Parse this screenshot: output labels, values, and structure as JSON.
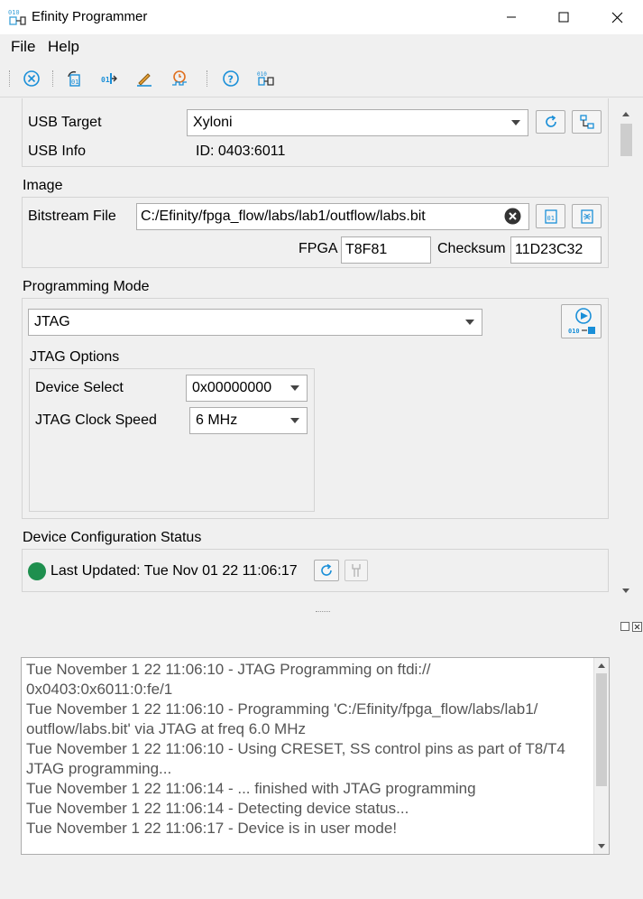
{
  "window": {
    "title": "Efinity Programmer"
  },
  "menu": {
    "file": "File",
    "help": "Help"
  },
  "toolbar": {
    "icons": [
      "stop-icon",
      "open-bitstream-icon",
      "output-icon",
      "edit-icon",
      "timing-icon",
      "help-icon",
      "programmer-icon"
    ]
  },
  "usb": {
    "target_label": "USB Target",
    "target_value": "Xyloni",
    "info_label": "USB Info",
    "info_value": "ID: 0403:6011"
  },
  "image": {
    "section_title": "Image",
    "bitstream_label": "Bitstream File",
    "bitstream_value": "C:/Efinity/fpga_flow/labs/lab1/outflow/labs.bit",
    "fpga_label": "FPGA",
    "fpga_value": "T8F81",
    "checksum_label": "Checksum",
    "checksum_value": "11D23C32"
  },
  "programming": {
    "section_title": "Programming Mode",
    "mode_value": "JTAG",
    "jtag_options_title": "JTAG Options",
    "device_select_label": "Device Select",
    "device_select_value": "0x00000000",
    "clock_speed_label": "JTAG Clock Speed",
    "clock_speed_value": "6 MHz"
  },
  "status": {
    "section_title": "Device Configuration Status",
    "last_updated": "Last Updated: Tue Nov 01 22 11:06:17",
    "indicator_color": "#1e8f4e"
  },
  "log": {
    "lines": [
      "Tue November 1 22 11:06:10 - JTAG Programming on ftdi://\n0x0403:0x6011:0:fe/1",
      "Tue November 1 22 11:06:10 - Programming 'C:/Efinity/fpga_flow/labs/lab1/\noutflow/labs.bit' via JTAG at freq 6.0 MHz",
      "Tue November 1 22 11:06:10 - Using CRESET, SS control pins as part of T8/T4\nJTAG programming...",
      "Tue November 1 22 11:06:14 - ... finished with JTAG programming",
      "Tue November 1 22 11:06:14 - Detecting device status...",
      "Tue November 1 22 11:06:17 - Device is in user mode!"
    ]
  },
  "colors": {
    "accent": "#1a8fd8"
  }
}
